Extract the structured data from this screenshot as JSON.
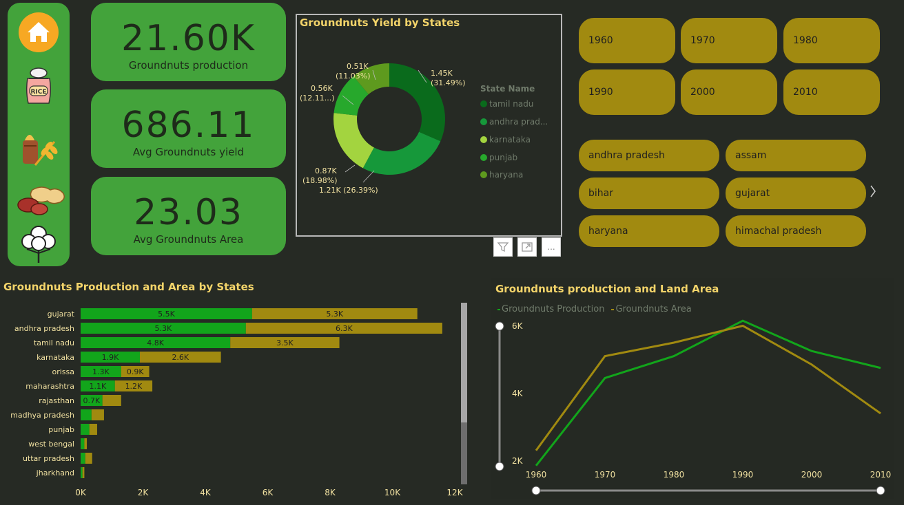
{
  "nav": {
    "items": [
      {
        "icon": "home-icon",
        "label": "Home"
      },
      {
        "icon": "rice-bag-icon",
        "label": "Rice"
      },
      {
        "icon": "wheat-icon",
        "label": "Wheat"
      },
      {
        "icon": "groundnut-icon",
        "label": "Groundnuts"
      },
      {
        "icon": "cotton-icon",
        "label": "Cotton"
      }
    ],
    "rice_text": "RICE"
  },
  "kpis": [
    {
      "value": "21.60K",
      "label": "Groundnuts production"
    },
    {
      "value": "686.11",
      "label": "Avg Groundnuts yield"
    },
    {
      "value": "23.03",
      "label": "Avg Groundnuts Area"
    }
  ],
  "donut": {
    "title": "Groundnuts Yield by States",
    "legend_title": "State Name",
    "legend": [
      "tamil nadu",
      "andhra prad...",
      "karnataka",
      "punjab",
      "haryana"
    ],
    "labels": [
      {
        "value": "1.45K",
        "pct": "(31.49%)"
      },
      {
        "value": "1.21K (26.39%)",
        "pct": ""
      },
      {
        "value": "0.87K",
        "pct": "(18.98%)"
      },
      {
        "value": "0.56K",
        "pct": "(12.11...)"
      },
      {
        "value": "0.51K",
        "pct": "(11.03%)"
      }
    ],
    "colors": [
      "#0a6b1c",
      "#16983a",
      "#a3d43f",
      "#27a82c",
      "#5e9a1e"
    ],
    "toolbar": {
      "filter": "filter-icon",
      "focus": "focus-mode-icon",
      "more": "..."
    }
  },
  "slicers": {
    "years": [
      "1960",
      "1970",
      "1980",
      "1990",
      "2000",
      "2010"
    ],
    "states": [
      "andhra pradesh",
      "assam",
      "bihar",
      "gujarat",
      "haryana",
      "himachal pradesh"
    ],
    "next_icon": "chevron-right-icon"
  },
  "chart_data": [
    {
      "type": "pie",
      "title": "Groundnuts Yield by States",
      "categories": [
        "tamil nadu",
        "andhra pradesh",
        "karnataka",
        "punjab",
        "haryana"
      ],
      "values": [
        1450,
        1210,
        870,
        560,
        510
      ],
      "percentages": [
        31.49,
        26.39,
        18.98,
        12.11,
        11.03
      ],
      "legend": "right"
    },
    {
      "type": "bar",
      "orientation": "horizontal",
      "stacked": true,
      "title": "Groundnuts Production and Area by States",
      "categories": [
        "gujarat",
        "andhra pradesh",
        "tamil nadu",
        "karnataka",
        "orissa",
        "maharashtra",
        "rajasthan",
        "madhya pradesh",
        "punjab",
        "west bengal",
        "uttar pradesh",
        "jharkhand"
      ],
      "series": [
        {
          "name": "Groundnuts Production",
          "color": "#12a51b",
          "values": [
            5.5,
            5.3,
            4.8,
            1.9,
            1.3,
            1.1,
            0.7,
            0.35,
            0.28,
            0.12,
            0.15,
            0.06
          ],
          "labels": [
            "5.5K",
            "5.3K",
            "4.8K",
            "1.9K",
            "1.3K",
            "1.1K",
            "0.7K",
            "",
            "",
            "",
            "",
            ""
          ]
        },
        {
          "name": "Groundnuts Area",
          "color": "#a18a10",
          "values": [
            5.3,
            6.3,
            3.5,
            2.6,
            0.9,
            1.2,
            0.6,
            0.4,
            0.25,
            0.08,
            0.22,
            0.06
          ],
          "labels": [
            "5.3K",
            "6.3K",
            "3.5K",
            "2.6K",
            "0.9K",
            "1.2K",
            "",
            "",
            "",
            "",
            "",
            ""
          ]
        }
      ],
      "x_ticks": [
        "0K",
        "2K",
        "4K",
        "6K",
        "8K",
        "10K",
        "12K"
      ],
      "xlim": [
        0,
        12
      ]
    },
    {
      "type": "line",
      "title": "Groundnuts production and Land Area",
      "x": [
        1960,
        1970,
        1980,
        1990,
        2000,
        2010
      ],
      "x_ticks": [
        "1960",
        "1970",
        "1980",
        "1990",
        "2000",
        "2010"
      ],
      "y_ticks": [
        "6K",
        "4K",
        "2K"
      ],
      "ylim": [
        1,
        6
      ],
      "series": [
        {
          "name": "Groundnuts Production",
          "color": "#12a51b",
          "values": [
            1.35,
            3.95,
            4.6,
            5.65,
            4.75,
            4.25
          ]
        },
        {
          "name": "Groundnuts Area",
          "color": "#a18a10",
          "values": [
            1.8,
            4.6,
            5.0,
            5.5,
            4.35,
            2.9
          ]
        }
      ],
      "legend": "top-left"
    }
  ]
}
